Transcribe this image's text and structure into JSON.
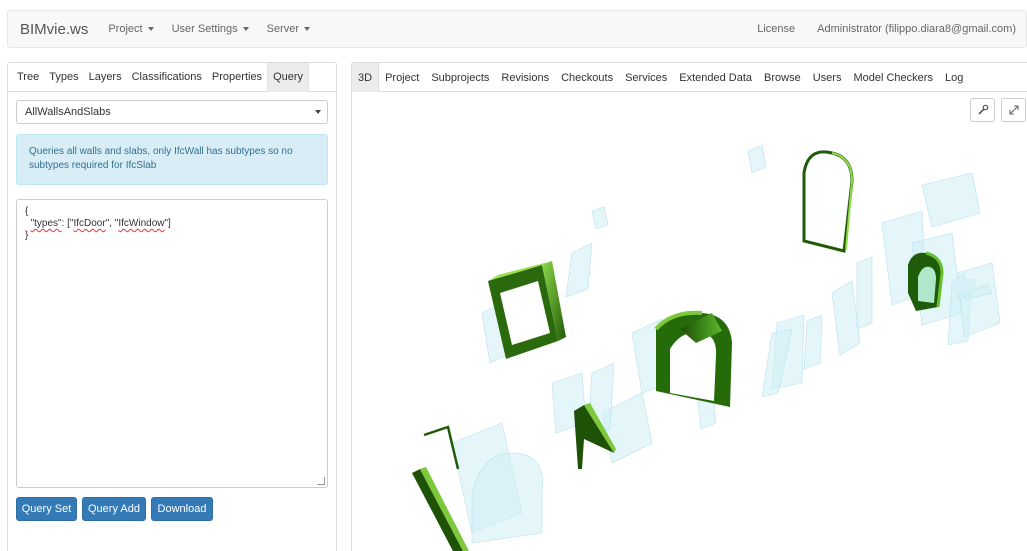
{
  "navbar": {
    "brand": "BIMvie.ws",
    "menus": [
      {
        "label": "Project"
      },
      {
        "label": "User Settings"
      },
      {
        "label": "Server"
      }
    ],
    "license": "License",
    "user": "Administrator (filippo.diara8@gmail.com)"
  },
  "left": {
    "tabs": [
      "Tree",
      "Types",
      "Layers",
      "Classifications",
      "Properties",
      "Query"
    ],
    "active_tab": "Query",
    "query_select": "AllWallsAndSlabs",
    "info_text": "Queries all walls and slabs, only IfcWall has subtypes so no subtypes required for IfcSlab",
    "editor": {
      "line1": "{",
      "key": "\"types\"",
      "colon": ": [\"",
      "value1": "IfcDoor",
      "sep": "\", \"",
      "value2": "IfcWindow",
      "end": "\"]",
      "line3": "}"
    },
    "buttons": {
      "query_set": "Query Set",
      "query_add": "Query Add",
      "download": "Download"
    }
  },
  "right": {
    "tabs": [
      "3D",
      "Project",
      "Subprojects",
      "Revisions",
      "Checkouts",
      "Services",
      "Extended Data",
      "Browse",
      "Users",
      "Model Checkers",
      "Log"
    ],
    "active_tab": "3D",
    "tools": [
      {
        "icon": "wrench-icon"
      },
      {
        "icon": "fullscreen-icon"
      }
    ]
  },
  "colors": {
    "primary": "#337ab7",
    "info_bg": "#d9edf7",
    "info_text": "#31708f",
    "selection_green": "#3a9a10",
    "ghost_cyan": "#cdeef4"
  }
}
